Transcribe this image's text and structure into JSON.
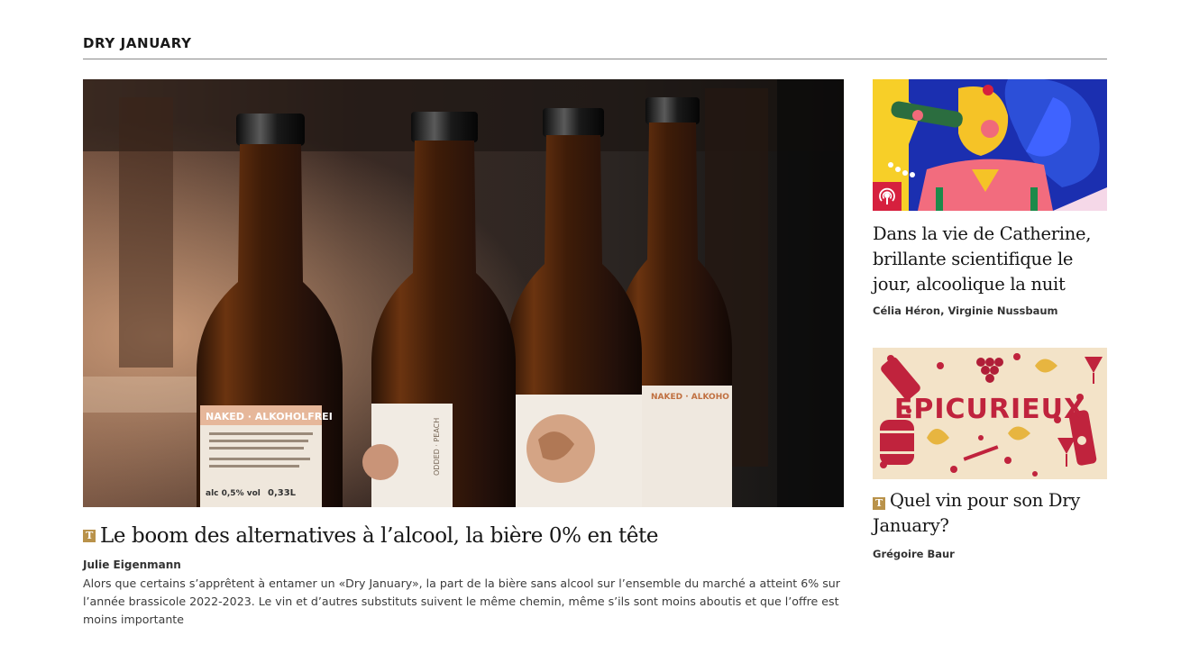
{
  "section": {
    "title": "DRY JANUARY"
  },
  "main_article": {
    "badge": "T",
    "title": "Le boom des alternatives à l’alcool, la bière 0% en tête",
    "author": "Julie Eigenmann",
    "lead": "Alors que certains s’apprêtent à entamer un «Dry January», la part de la bière sans alcool sur l’ensemble du marché a atteint 6% sur l’année brassicole 2022-2023. Le vin et d’autres substituts suivent le même chemin, même s’ils sont moins aboutis et que l’offre est moins importante",
    "image": {
      "label_1": "NAKED · ALKOHOLFREI",
      "label_2": "ODDED · PEACH",
      "label_4": "NAKED · ALKOHO",
      "alc": "alc 0,5% vol",
      "volume": "0,33L"
    }
  },
  "side_articles": [
    {
      "title": "Dans la vie de Catherine, brillante scientifique le jour, alcoolique la nuit",
      "authors": "Célia Héron, Virginie Nussbaum",
      "icon": "podcast-icon"
    },
    {
      "badge": "T",
      "title": "Quel vin pour son Dry January?",
      "authors": "Grégoire Baur",
      "image_text": "EPICURIEUX"
    }
  ],
  "colors": {
    "badge": "#b9924a",
    "podcast": "#d6203e",
    "illustration_bg": "#1b2fb0",
    "epicurieux_bg": "#f3e3c8",
    "epicurieux_red": "#c0233d"
  }
}
